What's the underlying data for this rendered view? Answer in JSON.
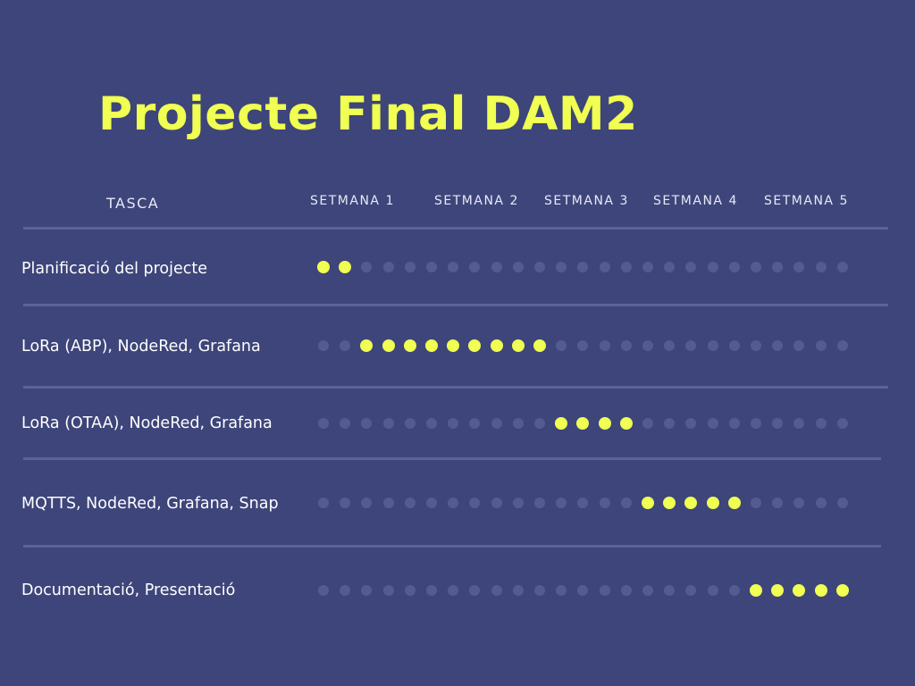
{
  "title": "Projecte Final DAM2",
  "header": {
    "task_label": "TASCA",
    "weeks": [
      "SETMANA 1",
      "SETMANA 2",
      "SETMANA 3",
      "SETMANA 4",
      "SETMANA 5"
    ]
  },
  "colors": {
    "background": "#3d457a",
    "accent": "#f0ff52",
    "inactive_dot": "#535b91",
    "divider": "#5a6399",
    "text": "#ffffff"
  },
  "dots_per_row": 25,
  "tasks": [
    {
      "label": "Planificació del projecte",
      "active_slots": [
        0,
        1
      ]
    },
    {
      "label": "LoRa (ABP), NodeRed, Grafana",
      "active_slots": [
        2,
        3,
        4,
        5,
        6,
        7,
        8,
        9,
        10
      ]
    },
    {
      "label": "LoRa (OTAA), NodeRed, Grafana",
      "active_slots": [
        11,
        12,
        13,
        14
      ]
    },
    {
      "label": "MQTTS, NodeRed, Grafana, Snap",
      "active_slots": [
        15,
        16,
        17,
        18,
        19
      ]
    },
    {
      "label": "Documentació, Presentació",
      "active_slots": [
        20,
        21,
        22,
        23,
        24
      ]
    }
  ]
}
